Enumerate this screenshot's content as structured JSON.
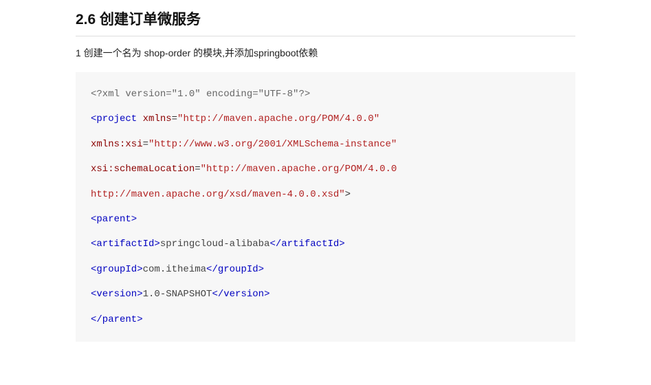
{
  "heading": "2.6 创建订单微服务",
  "intro": "1 创建一个名为 shop-order 的模块,并添加springboot依赖",
  "code": {
    "pi": "<?xml version=\"1.0\" encoding=\"UTF-8\"?>",
    "project_open": "<project",
    "xmlns_attr": " xmlns",
    "eq": "=",
    "xmlns_val": "\"http://maven.apache.org/POM/4.0.0\"",
    "xmlns_xsi_attr": "xmlns:xsi",
    "xmlns_xsi_val": "\"http://www.w3.org/2001/XMLSchema-instance\"",
    "schema_attr": "xsi:schemaLocation",
    "schema_val1": "\"http://maven.apache.org/POM/4.0.0",
    "schema_val2": "http://maven.apache.org/xsd/maven-4.0.0.xsd\"",
    "gt": ">",
    "parent_open": "<parent>",
    "artifact_open": "<artifactId>",
    "artifact_text": "springcloud-alibaba",
    "artifact_close": "</artifactId>",
    "group_open": "<groupId>",
    "group_text": "com.itheima",
    "group_close": "</groupId>",
    "version_open": "<version>",
    "version_text": "1.0-SNAPSHOT",
    "version_close": "</version>",
    "parent_close": "</parent>"
  }
}
